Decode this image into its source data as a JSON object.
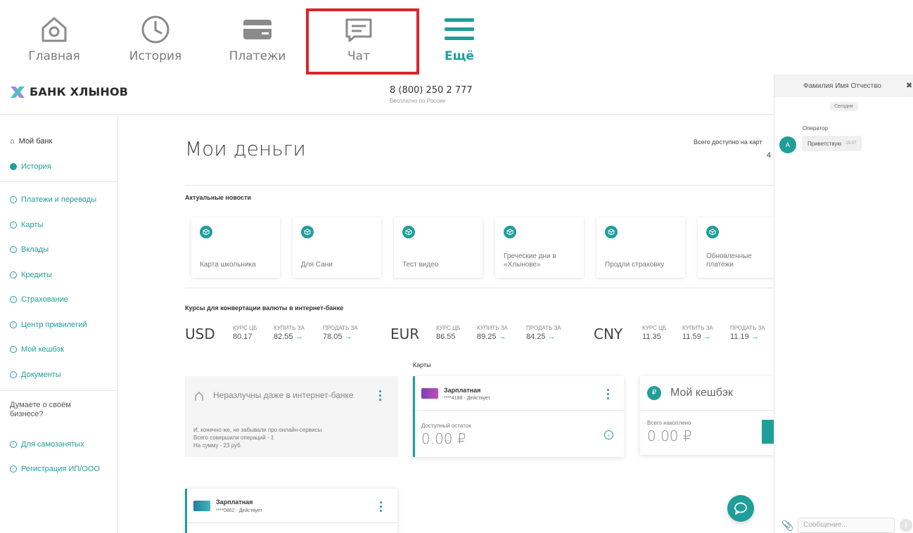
{
  "topnav": {
    "items": [
      {
        "label": "Главная",
        "icon": "home-icon"
      },
      {
        "label": "История",
        "icon": "clock-icon"
      },
      {
        "label": "Платежи",
        "icon": "card-icon"
      },
      {
        "label": "Чат",
        "icon": "chat-icon"
      },
      {
        "label": "Ещё",
        "icon": "menu-icon"
      }
    ],
    "active": "Ещё",
    "highlighted": "Чат",
    "highlight_color": "#d8262b"
  },
  "header": {
    "brand": "БАНК ХЛЫНОВ",
    "phone": "8 (800) 250 2 777",
    "phone_note": "Бесплатно по России"
  },
  "sidebar": {
    "items": [
      {
        "label": "Мой банк",
        "icon": "home-icon"
      },
      {
        "label": "История",
        "icon": "dot-icon"
      },
      {
        "label": "Платежи и переводы",
        "icon": "chevron-circle-icon"
      },
      {
        "label": "Карты",
        "icon": "chevron-circle-icon"
      },
      {
        "label": "Вклады",
        "icon": "chevron-circle-icon"
      },
      {
        "label": "Кредиты",
        "icon": "chevron-circle-icon"
      },
      {
        "label": "Страхование",
        "icon": "chevron-circle-icon"
      },
      {
        "label": "Центр привилегий",
        "icon": "chevron-circle-icon"
      },
      {
        "label": "Мой кешбэк",
        "icon": "chevron-circle-icon"
      },
      {
        "label": "Документы",
        "icon": "chevron-circle-icon"
      }
    ],
    "business_text": "Думаете о своём бизнесе?",
    "business_links": [
      "Для самозанятых",
      "Регистрация ИП/ООО"
    ]
  },
  "main": {
    "title": "Мои деньги",
    "total_label": "Всего доступно на карт",
    "total_value": "4",
    "news_title": "Актуальные новости",
    "news": [
      "Карта школьника",
      "Для Сани",
      "Тест видео",
      "Греческие дни в «Хлынове»",
      "Продли страховку",
      "Обновленные платежи"
    ],
    "fx_title": "Курсы для конвертации валюты в интернет-банке",
    "fx_headers": {
      "cb": "КУРС ЦБ",
      "buy": "КУПИТЬ ЗА",
      "sell": "ПРОДАТЬ ЗА"
    },
    "fx": [
      {
        "code": "USD",
        "cb": "80.17",
        "buy": "82.55",
        "sell": "78.05"
      },
      {
        "code": "EUR",
        "cb": "86.55",
        "buy": "89.25",
        "sell": "84.25"
      },
      {
        "code": "CNY",
        "cb": "11.35",
        "buy": "11.59",
        "sell": "11.19"
      }
    ],
    "arrow": "→",
    "cards_title": "Карты",
    "promo": {
      "title": "Неразлучны даже в интернет-банке",
      "text1": "И, конечно же, не забывали про онлайн-сервисы",
      "text2": "Всего совершили операций - 1",
      "text3": "На сумму - 23 руб."
    },
    "card1": {
      "name": "Зарплатная",
      "status": "****4188 - Действует",
      "balance_label": "Доступный остаток",
      "balance": "0.00 ₽"
    },
    "cashback": {
      "title": "Мой кешбэк",
      "label": "Всего накоплено",
      "value": "0.00 ₽"
    },
    "card2": {
      "name": "Зарплатная",
      "status": "****0862 - Действует"
    }
  },
  "chat": {
    "operator_name": "Фамилия Имя Отчество",
    "close": "✖",
    "today": "Сегодня",
    "operator_label": "Оператор",
    "avatar_letter": "А",
    "message": "Приветствую",
    "message_time": "15:07",
    "input_placeholder": "Сообщение...",
    "info": "i"
  },
  "colors": {
    "accent": "#1f9e9a",
    "highlight": "#d8262b"
  }
}
